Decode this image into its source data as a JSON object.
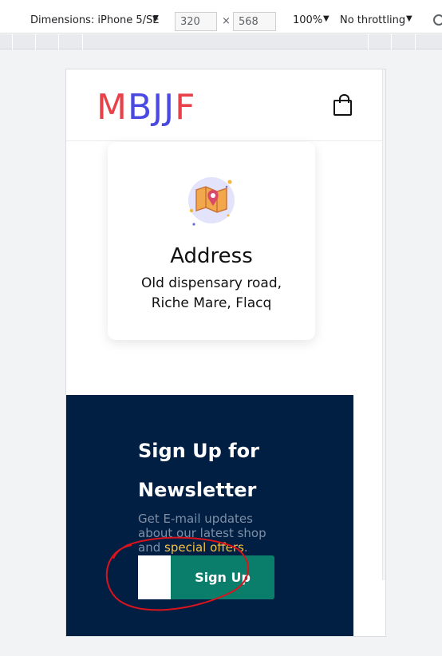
{
  "devtools": {
    "dimensions_label": "Dimensions: iPhone 5/SE",
    "width_value": "320",
    "times": "×",
    "height_value": "568",
    "zoom": "100%",
    "throttling": "No throttling",
    "arrow": "▼",
    "rotate_icon": "rotate-icon"
  },
  "header": {
    "logo_letters": [
      {
        "char": "M",
        "color": "#e8414a"
      },
      {
        "char": "B",
        "color": "#4a4ae3"
      },
      {
        "char": "J",
        "color": "#4a4ae3"
      },
      {
        "char": "J",
        "color": "#4a4ae3"
      },
      {
        "char": "F",
        "color": "#e8414a"
      }
    ],
    "cart_icon": "shopping-bag-icon"
  },
  "address": {
    "icon": "map-pin-icon",
    "title": "Address",
    "line1": "Old dispensary road,",
    "line2": "Riche Mare, Flacq"
  },
  "newsletter": {
    "title_line1": "Sign Up for",
    "title_line2": "Newsletter",
    "desc_line1": "Get E-mail updates",
    "desc_line2": "about our latest shop",
    "desc_line3_prefix": "and ",
    "desc_highlight": "special offers",
    "desc_suffix": ".",
    "email_placeholder": "",
    "signup_label": "Sign Up"
  },
  "colors": {
    "newsletter_bg": "#011f43",
    "signup_button": "#0a7d6b",
    "highlight": "#f6c343",
    "annotation": "#d9141c"
  }
}
